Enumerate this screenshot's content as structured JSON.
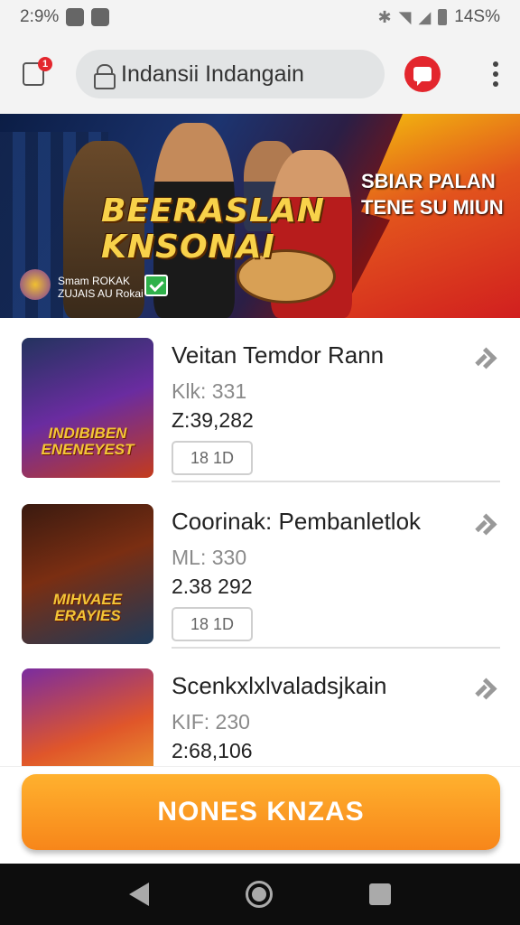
{
  "status_bar": {
    "time": "2:9%",
    "battery": "14S%"
  },
  "browser": {
    "url": "Indansii Indangain",
    "cart_badge": "1"
  },
  "hero": {
    "title_line1": "BEERASLAN",
    "title_line2": "KNSONAI",
    "right_line1": "SBIAR PALAN",
    "right_line2": "TENE SU MIUN",
    "brand_line1": "Smam ROKAK",
    "brand_line2": "ZUJAIS AU Rokai"
  },
  "items": [
    {
      "title": "Veitan Temdor Rann",
      "line1": "Klk: 331",
      "line2": "Z:39,282",
      "button": "18 1D",
      "thumb_text": "INDIBIBEN ENENEYEST"
    },
    {
      "title": "Coorinak: Pembanletlok",
      "line1": "ML: 330",
      "line2": "2.38 292",
      "button": "18 1D",
      "thumb_text": "MIHVAEE ERAYIES"
    },
    {
      "title": "Scenkxlxlvaladsjkain",
      "line1": "KIF: 230",
      "line2": "2:68,106",
      "button": "",
      "thumb_text": ""
    }
  ],
  "cta": {
    "label": "NONES KNZAS"
  },
  "colors": {
    "accent": "#e3262d",
    "cta_top": "#ffb12e",
    "cta_bottom": "#f7861a"
  }
}
